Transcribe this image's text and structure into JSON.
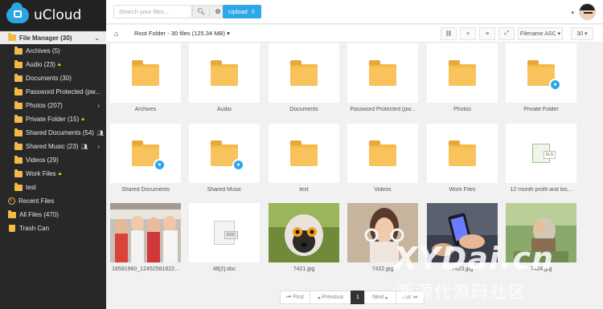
{
  "app": {
    "name": "uCloud"
  },
  "sidebar": {
    "items": [
      {
        "label": "File Manager (30)"
      },
      {
        "label": "Archives (5)"
      },
      {
        "label": "Audio (23)"
      },
      {
        "label": "Documents (30)"
      },
      {
        "label": "Password Protected (pw..."
      },
      {
        "label": "Photos (207)"
      },
      {
        "label": "Private Folder (15)"
      },
      {
        "label": "Shared Documents (54)"
      },
      {
        "label": "Shared Music (23)"
      },
      {
        "label": "Videos (29)"
      },
      {
        "label": "Work Files"
      },
      {
        "label": "test"
      },
      {
        "label": "Recent Files"
      },
      {
        "label": "All Files (470)"
      },
      {
        "label": "Trash Can"
      }
    ]
  },
  "topbar": {
    "search_placeholder": "Search your files...",
    "upload_label": "Upload"
  },
  "toolbar": {
    "breadcrumb": "Root Folder - 30 files (125.34 MB)",
    "sort": "Filename ASC",
    "per_page": "30"
  },
  "files": [
    {
      "name": "Archives",
      "type": "folder"
    },
    {
      "name": "Audio",
      "type": "folder"
    },
    {
      "name": "Documents",
      "type": "folder"
    },
    {
      "name": "Password Protected (pw...",
      "type": "folder"
    },
    {
      "name": "Photos",
      "type": "folder"
    },
    {
      "name": "Private Folder",
      "type": "folder-shared"
    },
    {
      "name": "Shared Documents",
      "type": "folder-shared"
    },
    {
      "name": "Shared Music",
      "type": "folder-shared"
    },
    {
      "name": "test",
      "type": "folder"
    },
    {
      "name": "Videos",
      "type": "folder"
    },
    {
      "name": "Work Files",
      "type": "folder"
    },
    {
      "name": "12 month profit and los...",
      "type": "xls",
      "ext": "XLS"
    },
    {
      "name": "18581960_12452581822...",
      "type": "photo"
    },
    {
      "name": "48[2].doc",
      "type": "doc",
      "ext": "DOC"
    },
    {
      "name": "7421.jpg",
      "type": "photo"
    },
    {
      "name": "7422.jpg",
      "type": "photo"
    },
    {
      "name": "7423.jpg",
      "type": "photo"
    },
    {
      "name": "7424.jpg",
      "type": "photo"
    }
  ],
  "pagination": {
    "first": "First",
    "previous": "Previous",
    "current": "1",
    "next": "Next",
    "last": "Last"
  },
  "watermark": {
    "line1": "XYDai.cn",
    "line2": "新源代源码社区"
  },
  "colors": {
    "accent": "#2ea7e8",
    "folder": "#f5b94a",
    "sidebar": "#282828"
  }
}
